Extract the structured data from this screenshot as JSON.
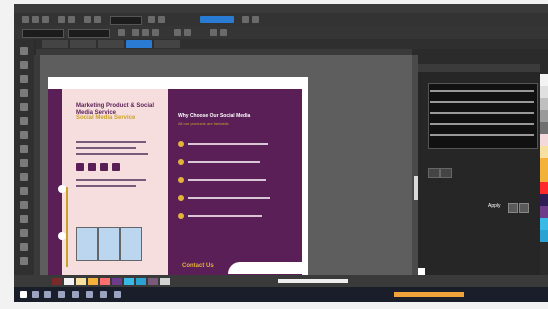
{
  "window": {
    "title": ""
  },
  "menubar": {
    "items": [
      "",
      "",
      "",
      "",
      "",
      "",
      "",
      "",
      "",
      "",
      ""
    ]
  },
  "document": {
    "tab_labels": [
      "",
      "",
      "",
      "",
      ""
    ],
    "headline": "Marketing Product & Social Media Service",
    "subhead": "Social Media Service",
    "right_title": "Why Choose Our Social Media",
    "right_subtitle": "All our products are fantastic",
    "cta": "Contact Us"
  },
  "panel": {
    "title": "",
    "apply_label": "Apply"
  },
  "palette": {
    "colors": [
      "#f3f3f3",
      "#e0e0e0",
      "#bfbfbf",
      "#9a9a9a",
      "#707070",
      "#f3d9d9",
      "#f7e0a0",
      "#f5b23a",
      "#f2b23a",
      "#ff2a2a",
      "#2e1c55",
      "#6c3c8a",
      "#39b9e6",
      "#2aa3d3"
    ]
  },
  "statusbar": {
    "swatches": [
      "#7a2a2a",
      "#f2f2f2",
      "#f7e0a0",
      "#f5b23a",
      "#ff6f6f",
      "#6c3c8a",
      "#39b9e6",
      "#2aa3d3",
      "#7a5a7a",
      "#d2d2d2"
    ]
  },
  "taskbar": {
    "time": ""
  }
}
